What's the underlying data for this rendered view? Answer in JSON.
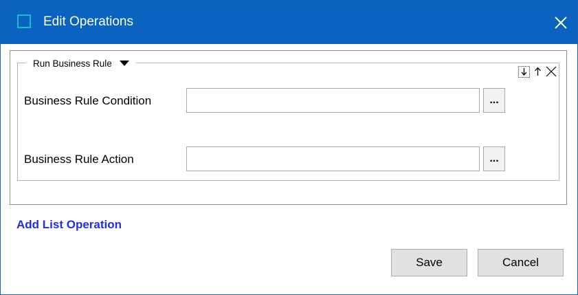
{
  "window": {
    "title": "Edit Operations",
    "title_bar_color": "#0a63c1"
  },
  "operation": {
    "group_title": "Run Business Rule",
    "fields": [
      {
        "label": "Business Rule Condition",
        "value": "",
        "button_label": "..."
      },
      {
        "label": "Business Rule Action",
        "value": "",
        "button_label": "..."
      }
    ]
  },
  "links": {
    "add_list_operation": "Add List Operation",
    "link_color": "#1f2bf2"
  },
  "buttons": {
    "save": "Save",
    "cancel": "Cancel"
  },
  "icons": {
    "window": "window-icon",
    "close": "close-icon",
    "group_menu": "caret-down-icon",
    "insert": "insert-below-icon",
    "move_up": "arrow-up-icon",
    "remove": "close-small-icon"
  }
}
